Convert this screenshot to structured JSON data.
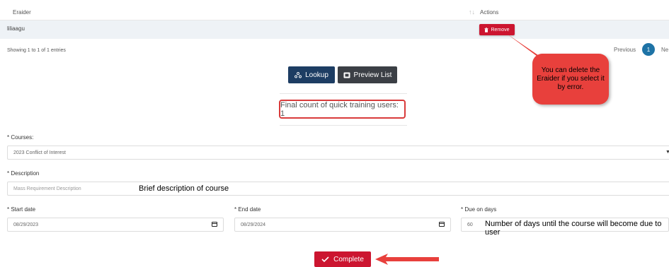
{
  "table": {
    "col_eraider": "Eraider",
    "col_actions": "Actions",
    "sort_indicator": "↑↓",
    "row_name": "liliaagu",
    "remove_label": "Remove"
  },
  "pagination": {
    "showing": "Showing 1 to 1 of 1 entries",
    "previous": "Previous",
    "current": "1",
    "next": "Ne"
  },
  "buttons": {
    "lookup": "Lookup",
    "preview": "Preview List",
    "complete": "Complete"
  },
  "callout": {
    "text": "You can delete the Eraider if you select it by error."
  },
  "final_count": "Final count of quick training users: 1",
  "form": {
    "courses_label": "* Courses:",
    "courses_value": "2023 Conflict of Interest",
    "description_label": "* Description",
    "description_placeholder": "Mass Requirement Description",
    "description_annotation": "Brief description of course",
    "start_label": "* Start date",
    "start_value": "08/29/2023",
    "end_label": "* End date",
    "end_value": "08/29/2024",
    "due_label": "* Due on days",
    "due_value": "60",
    "due_annotation": "Number of days until the course will become due to user"
  },
  "colors": {
    "remove": "#cc1530",
    "lookup": "#1d3d63",
    "preview": "#3b3f45",
    "callout": "#e8403c",
    "pager": "#1e73a6"
  }
}
